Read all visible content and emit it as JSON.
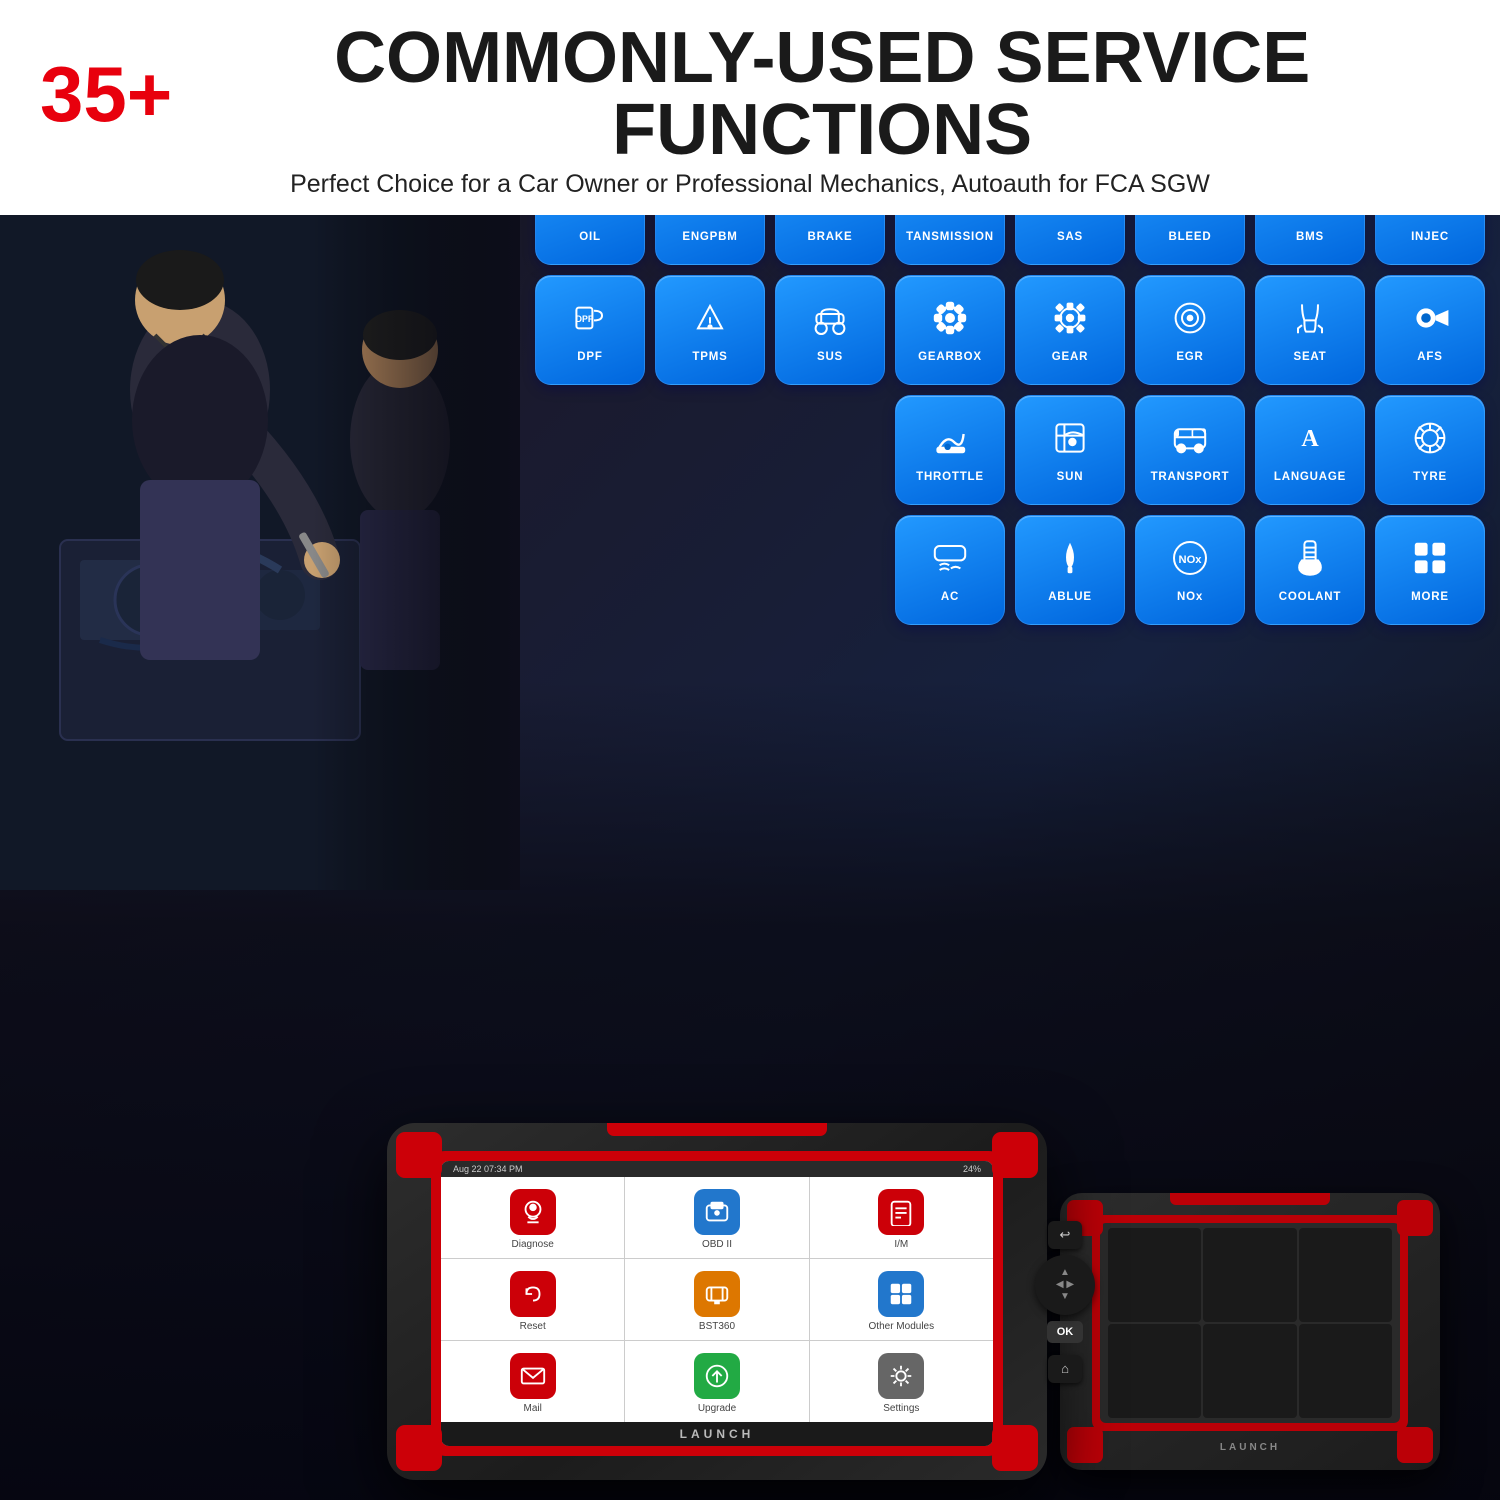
{
  "header": {
    "highlight": "35+",
    "title": "COMMONLY-USED SERVICE FUNCTIONS",
    "subtitle": "Perfect Choice for a Car Owner or Professional Mechanics, Autoauth for FCA SGW"
  },
  "colors": {
    "red": "#e8000d",
    "blue": "#1e90ff",
    "dark": "#1a1a1a",
    "white": "#ffffff"
  },
  "row1": [
    {
      "label": "OIL",
      "icon": "🛢"
    },
    {
      "label": "ENGPBM",
      "icon": "⚙"
    },
    {
      "label": "BRAKE",
      "icon": "⊙"
    },
    {
      "label": "TANSMISSION",
      "icon": "🔧"
    },
    {
      "label": "SAS",
      "icon": "🎡"
    },
    {
      "label": "BLEED",
      "icon": "⊛"
    },
    {
      "label": "BMS",
      "icon": "🔋"
    },
    {
      "label": "INJEC",
      "icon": "💉"
    }
  ],
  "row2": [
    {
      "label": "DPF",
      "icon": "▦"
    },
    {
      "label": "TPMS",
      "icon": "⚠"
    },
    {
      "label": "SUS",
      "icon": "🚗"
    },
    {
      "label": "GEARBOX",
      "icon": "⚙"
    },
    {
      "label": "GEAR",
      "icon": "⚙"
    },
    {
      "label": "EGR",
      "icon": "◎"
    },
    {
      "label": "SEAT",
      "icon": "🪑"
    },
    {
      "label": "AFS",
      "icon": "⟹"
    }
  ],
  "row3": [
    {
      "label": "THROTTLE",
      "icon": "👟"
    },
    {
      "label": "SUN",
      "icon": "🪟"
    },
    {
      "label": "TRANSPORT",
      "icon": "🚗"
    },
    {
      "label": "LANGUAGE",
      "icon": "A"
    },
    {
      "label": "TYRE",
      "icon": "◎"
    }
  ],
  "row4": [
    {
      "label": "AC",
      "icon": "❄"
    },
    {
      "label": "ABLUE",
      "icon": "💧"
    },
    {
      "label": "NOx",
      "icon": "NOx"
    },
    {
      "label": "COOLANT",
      "icon": "🌡"
    },
    {
      "label": "MORE",
      "icon": "⊞"
    }
  ],
  "device": {
    "statusbar": {
      "date": "Aug 22  07:34 PM",
      "battery": "24%"
    },
    "apps": [
      {
        "label": "Diagnose",
        "icon": "🔍",
        "color": "red"
      },
      {
        "label": "OBD II",
        "icon": "🚗",
        "color": "blue"
      },
      {
        "label": "I/M",
        "icon": "📋",
        "color": "red"
      },
      {
        "label": "Reset",
        "icon": "🔄",
        "color": "red"
      },
      {
        "label": "BST360",
        "icon": "🧰",
        "color": "orange"
      },
      {
        "label": "Other Modules",
        "icon": "📦",
        "color": "blue"
      },
      {
        "label": "Mail",
        "icon": "✉",
        "color": "red"
      },
      {
        "label": "Upgrade",
        "icon": "⬇",
        "color": "green"
      },
      {
        "label": "Settings",
        "icon": "⚙",
        "color": "gray"
      }
    ],
    "brand": "LAUNCH"
  }
}
